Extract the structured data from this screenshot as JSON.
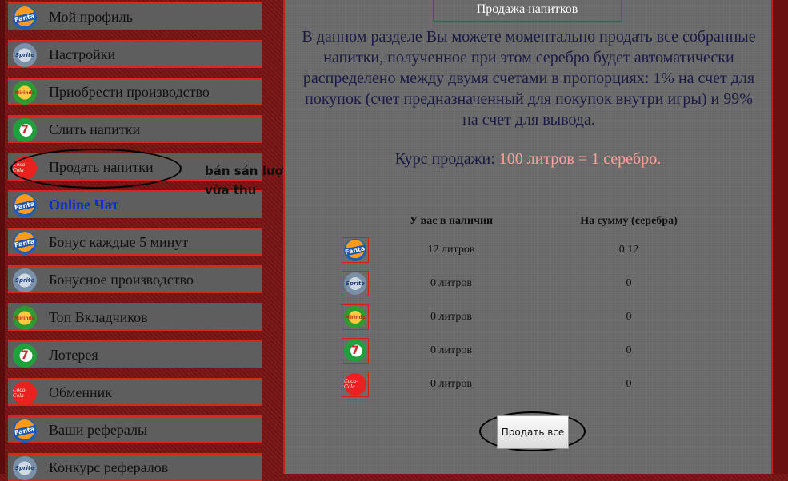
{
  "menu": {
    "items": [
      {
        "label": "Мой профиль",
        "icon": "fanta-icon",
        "icon_text": "Fanta"
      },
      {
        "label": "Настройки",
        "icon": "sprite-icon",
        "icon_text": "Sprite"
      },
      {
        "label": "Приобрести производство",
        "icon": "mirinda-icon",
        "icon_text": "Mirinda"
      },
      {
        "label": "Слить напитки",
        "icon": "7up-icon",
        "icon_text": "7"
      },
      {
        "label": "Продать напитки",
        "icon": "coca-cola-icon",
        "icon_text": "Coca-Cola"
      },
      {
        "label": "Online Чат",
        "icon": "fanta-icon",
        "icon_text": "Fanta"
      },
      {
        "label": "Бонус каждые 5 минут",
        "icon": "fanta-icon",
        "icon_text": "Fanta"
      },
      {
        "label": "Бонусное производство",
        "icon": "sprite-icon",
        "icon_text": "Sprite"
      },
      {
        "label": "Топ Вкладчиков",
        "icon": "mirinda-icon",
        "icon_text": "Mirinda"
      },
      {
        "label": "Лотерея",
        "icon": "7up-icon",
        "icon_text": "7"
      },
      {
        "label": "Обменник",
        "icon": "coca-cola-icon",
        "icon_text": "Coca-Cola"
      },
      {
        "label": "Ваши рефералы",
        "icon": "fanta-icon",
        "icon_text": "Fanta"
      },
      {
        "label": "Конкурс рефералов",
        "icon": "sprite-icon",
        "icon_text": "Sprite"
      }
    ]
  },
  "annotation": {
    "text": "bán sản lượng vừa thu"
  },
  "main": {
    "title": "Продажа напитков",
    "description": "В данном разделе Вы можете моментально продать все собранные напитки, полученное при этом серебро будет автоматически распределено между двумя счетами в пропорциях: 1% на счет для покупок (счет предназначенный для покупок внутри игры) и 99% на счет для вывода.",
    "rate_label": "Курс продажи:",
    "rate_value": "100 литров = 1 серебро.",
    "table": {
      "headers": [
        "У вас в наличии",
        "На сумму (серебра)"
      ],
      "rows": [
        {
          "icon": "fanta-icon",
          "icon_text": "Fanta",
          "amount": "12 литров",
          "sum": "0.12"
        },
        {
          "icon": "sprite-icon",
          "icon_text": "Sprite",
          "amount": "0 литров",
          "sum": "0"
        },
        {
          "icon": "mirinda-icon",
          "icon_text": "Mirinda",
          "amount": "0 литров",
          "sum": "0"
        },
        {
          "icon": "7up-icon",
          "icon_text": "7",
          "amount": "0 литров",
          "sum": "0"
        },
        {
          "icon": "coca-cola-icon",
          "icon_text": "Coca-Cola",
          "amount": "0 литров",
          "sum": "0"
        }
      ]
    },
    "sell_button": "Продать все"
  },
  "colors": {
    "accent_red": "#d42020",
    "rate_value": "#ff9e96",
    "chat_link": "#0a2bd8"
  }
}
